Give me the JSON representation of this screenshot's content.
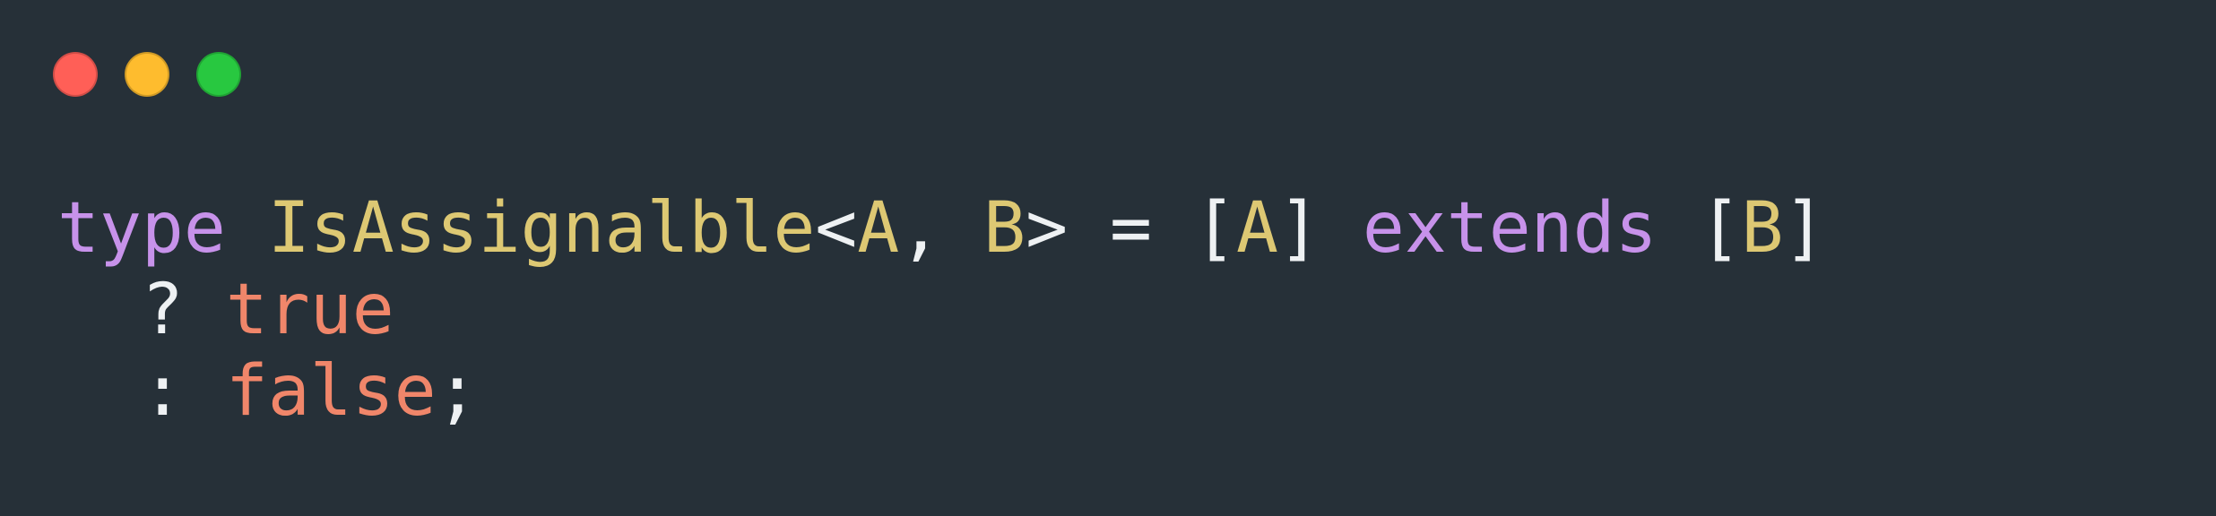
{
  "window": {
    "controls": [
      {
        "name": "close",
        "color": "#ff5f57"
      },
      {
        "name": "minimize",
        "color": "#febc2e"
      },
      {
        "name": "maximize",
        "color": "#28c840"
      }
    ]
  },
  "code": {
    "theme": {
      "background": "#263038",
      "keyword": "#c792ea",
      "type": "#ddc873",
      "literal": "#f0866a",
      "punctuation": "#eef1f3"
    },
    "lines": [
      {
        "tokens": [
          {
            "kind": "kw",
            "text": "type"
          },
          {
            "kind": "pun",
            "text": " "
          },
          {
            "kind": "ty",
            "text": "IsAssignalble"
          },
          {
            "kind": "pun",
            "text": "<"
          },
          {
            "kind": "ty",
            "text": "A"
          },
          {
            "kind": "pun",
            "text": ", "
          },
          {
            "kind": "ty",
            "text": "B"
          },
          {
            "kind": "pun",
            "text": "> = ["
          },
          {
            "kind": "ty",
            "text": "A"
          },
          {
            "kind": "pun",
            "text": "] "
          },
          {
            "kind": "kw",
            "text": "extends"
          },
          {
            "kind": "pun",
            "text": " ["
          },
          {
            "kind": "ty",
            "text": "B"
          },
          {
            "kind": "pun",
            "text": "]"
          }
        ]
      },
      {
        "tokens": [
          {
            "kind": "pun",
            "text": "  ? "
          },
          {
            "kind": "lit",
            "text": "true"
          }
        ]
      },
      {
        "tokens": [
          {
            "kind": "pun",
            "text": "  : "
          },
          {
            "kind": "lit",
            "text": "false"
          },
          {
            "kind": "pun",
            "text": ";"
          }
        ]
      }
    ]
  }
}
